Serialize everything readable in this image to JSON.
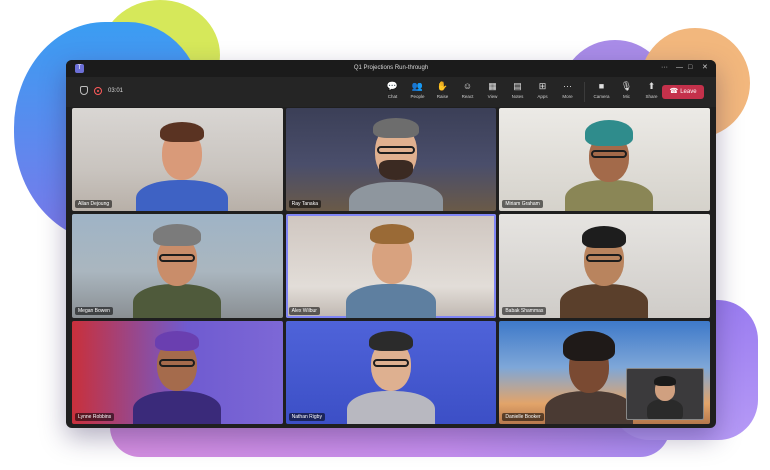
{
  "window": {
    "title": "Q1 Projections Run-through",
    "minimize_glyph": "—",
    "maximize_glyph": "□",
    "close_glyph": "✕",
    "more_glyph": "···"
  },
  "toolbar": {
    "timer": "03:01",
    "chat": {
      "label": "Chat",
      "icon": "chat-icon",
      "glyph": "💬"
    },
    "people": {
      "label": "People",
      "icon": "people-icon",
      "glyph": "👥"
    },
    "raise": {
      "label": "Raise",
      "icon": "hand-icon",
      "glyph": "✋"
    },
    "react": {
      "label": "React",
      "icon": "smile-icon",
      "glyph": "☺"
    },
    "view": {
      "label": "View",
      "icon": "grid-icon",
      "glyph": "▦"
    },
    "notes": {
      "label": "Notes",
      "icon": "notes-icon",
      "glyph": "▤"
    },
    "apps": {
      "label": "Apps",
      "icon": "apps-icon",
      "glyph": "⊞"
    },
    "more": {
      "label": "More",
      "icon": "more-icon",
      "glyph": "···"
    },
    "camera": {
      "label": "Camera",
      "icon": "camera-icon",
      "glyph": "■"
    },
    "mic": {
      "label": "Mic",
      "icon": "mic-icon",
      "glyph": "🎙"
    },
    "share": {
      "label": "Share",
      "icon": "share-icon",
      "glyph": "⬆"
    },
    "leave_label": "Leave",
    "leave_glyph": "☎"
  },
  "participants": [
    {
      "name": "Allan Dejoung",
      "background": "office"
    },
    {
      "name": "Ray Tanaka",
      "background": "loft"
    },
    {
      "name": "Miriam Graham",
      "background": "white-room"
    },
    {
      "name": "Megan Bowen",
      "background": "city-window"
    },
    {
      "name": "Alex Wilbur",
      "background": "room",
      "active": true
    },
    {
      "name": "Babak Shammas",
      "background": "stairs"
    },
    {
      "name": "Lynne Robbins",
      "background": "red-room"
    },
    {
      "name": "Nathan Rigby",
      "background": "blue-wall"
    },
    {
      "name": "Danielle Booker",
      "background": "sunset"
    }
  ],
  "colors": {
    "leave": "#c4314b",
    "accent": "#7f85f5",
    "window_bg": "#1f1f1f"
  }
}
